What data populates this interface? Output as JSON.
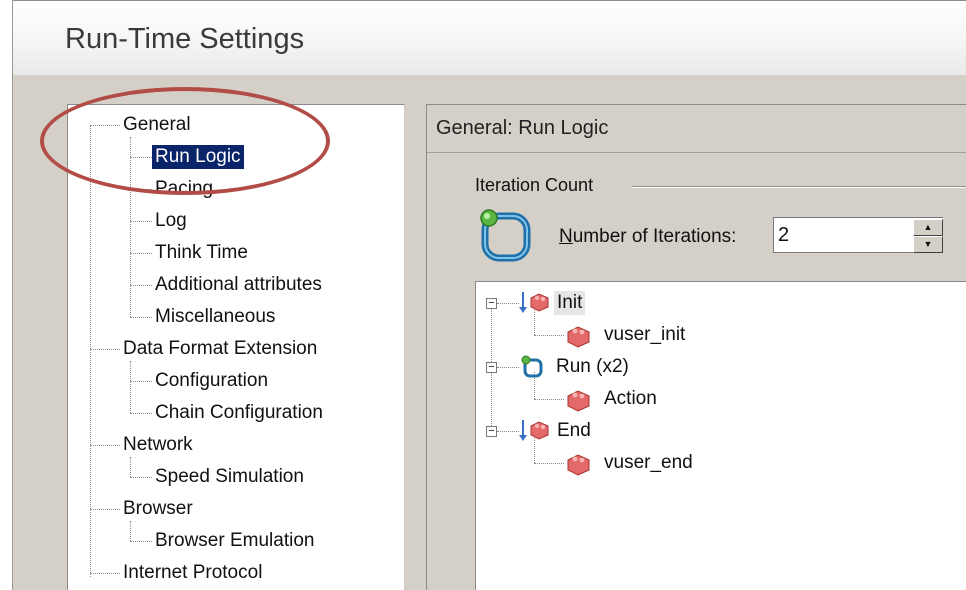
{
  "window": {
    "title": "Run-Time Settings"
  },
  "tree": {
    "items": [
      {
        "label": "General",
        "level": 0,
        "selected": false
      },
      {
        "label": "Run Logic",
        "level": 1,
        "selected": true
      },
      {
        "label": "Pacing",
        "level": 1,
        "selected": false
      },
      {
        "label": "Log",
        "level": 1,
        "selected": false
      },
      {
        "label": "Think Time",
        "level": 1,
        "selected": false
      },
      {
        "label": "Additional attributes",
        "level": 1,
        "selected": false
      },
      {
        "label": "Miscellaneous",
        "level": 1,
        "selected": false
      },
      {
        "label": "Data Format Extension",
        "level": 0,
        "selected": false
      },
      {
        "label": "Configuration",
        "level": 1,
        "selected": false
      },
      {
        "label": "Chain Configuration",
        "level": 1,
        "selected": false
      },
      {
        "label": "Network",
        "level": 0,
        "selected": false
      },
      {
        "label": "Speed Simulation",
        "level": 1,
        "selected": false
      },
      {
        "label": "Browser",
        "level": 0,
        "selected": false
      },
      {
        "label": "Browser Emulation",
        "level": 1,
        "selected": false
      },
      {
        "label": "Internet Protocol",
        "level": 0,
        "selected": false
      }
    ]
  },
  "panel": {
    "header": "General: Run Logic",
    "group_label": "Iteration Count",
    "iterations_label_prefix": "N",
    "iterations_label_rest": "umber of Iterations:",
    "iterations_value": "2"
  },
  "action_tree": {
    "nodes": [
      {
        "label": "Init",
        "icon": "init-block-icon"
      },
      {
        "label": "vuser_init",
        "icon": "action-block-icon"
      },
      {
        "label": "Run (x2)",
        "icon": "run-loop-icon"
      },
      {
        "label": "Action",
        "icon": "action-block-icon"
      },
      {
        "label": "End",
        "icon": "end-block-icon"
      },
      {
        "label": "vuser_end",
        "icon": "action-block-icon"
      }
    ]
  },
  "colors": {
    "selection": "#0a246a",
    "highlight_oval": "#b24c47",
    "dialog_bg": "#d4d0c8"
  }
}
